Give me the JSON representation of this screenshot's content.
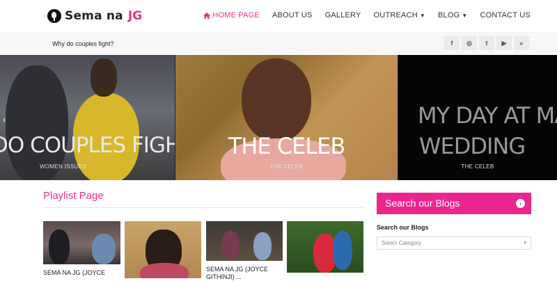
{
  "brand": {
    "name": "Sema na",
    "accent": "JG"
  },
  "nav": {
    "items": [
      {
        "label": "HOME PAGE",
        "active": true
      },
      {
        "label": "ABOUT US",
        "active": false
      },
      {
        "label": "GALLERY",
        "active": false
      },
      {
        "label": "OUTREACH",
        "active": false,
        "dropdown": true
      },
      {
        "label": "BLOG",
        "active": false,
        "dropdown": true
      },
      {
        "label": "CONTACT US",
        "active": false
      }
    ]
  },
  "ticker": {
    "text": "Why do couples fight?"
  },
  "social": {
    "icons": [
      "facebook-icon",
      "instagram-icon",
      "twitter-icon",
      "youtube-icon",
      "search-icon"
    ],
    "glyphs": [
      "f",
      "◎",
      "t",
      "▶",
      "⌕"
    ]
  },
  "slides": [
    {
      "caption": "DO COUPLES FIGHT?",
      "category": "WOMEN ISSUES"
    },
    {
      "caption": "THE CELEB",
      "category": "THE CELEB"
    },
    {
      "caption_line1": "MY DAY AT MACHO",
      "caption_line2": "WEDDING",
      "category": "THE CELEB"
    }
  ],
  "playlist": {
    "title": "Playlist Page",
    "items": [
      {
        "caption_line1": "SEMA NA JG (JOYCE",
        "caption_line2": ""
      },
      {
        "caption_line1": "",
        "caption_line2": ""
      },
      {
        "caption_line1": "SEMA NA JG (JOYCE",
        "caption_line2": "GITHINJI) ..."
      },
      {
        "caption_line1": "",
        "caption_line2": ""
      }
    ]
  },
  "sidebar": {
    "search_title": "Search our Blogs",
    "search_label": "Search our Blogs",
    "select_placeholder": "Select Category"
  },
  "colors": {
    "accent": "#e8308a",
    "button": "#ec268f"
  }
}
